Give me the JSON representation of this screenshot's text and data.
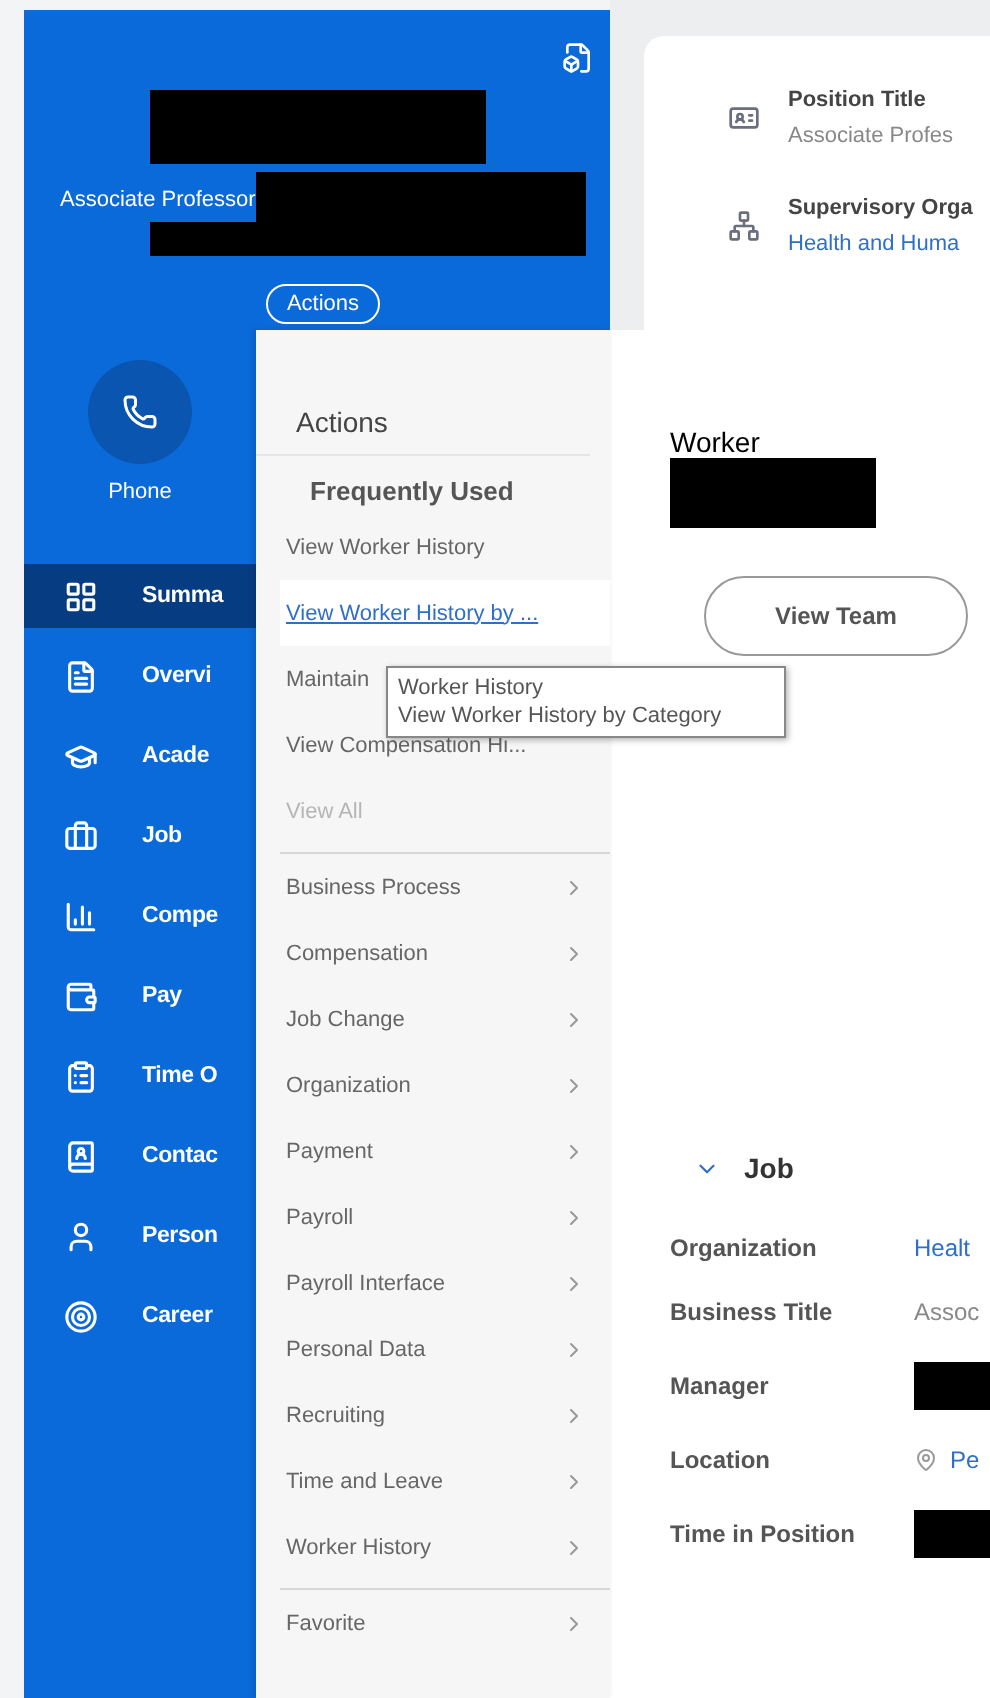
{
  "profile": {
    "subtitle": "Associate Professor",
    "actions_button": "Actions",
    "contact": {
      "label": "Phone"
    }
  },
  "nav": [
    {
      "label": "Summa",
      "selected": true
    },
    {
      "label": "Overvi",
      "selected": false
    },
    {
      "label": "Acade",
      "selected": false
    },
    {
      "label": "Job",
      "selected": false
    },
    {
      "label": "Compe",
      "selected": false
    },
    {
      "label": "Pay",
      "selected": false
    },
    {
      "label": "Time O",
      "selected": false
    },
    {
      "label": "Contac",
      "selected": false
    },
    {
      "label": "Person",
      "selected": false
    },
    {
      "label": "Career",
      "selected": false
    }
  ],
  "actions_menu": {
    "title": "Actions",
    "sections": [
      {
        "heading": "Frequently Used",
        "items": [
          {
            "label": "View Worker History",
            "kind": "action",
            "highlighted": false,
            "disabled": false
          },
          {
            "label": "View Worker History by ...",
            "kind": "action",
            "highlighted": true,
            "disabled": false
          },
          {
            "label": "Maintain",
            "kind": "action",
            "highlighted": false,
            "disabled": false
          },
          {
            "label": "View Compensation Hi...",
            "kind": "action",
            "highlighted": false,
            "disabled": false
          },
          {
            "label": "View All",
            "kind": "action",
            "highlighted": false,
            "disabled": true
          }
        ]
      },
      {
        "items": [
          {
            "label": "Business Process",
            "kind": "submenu"
          },
          {
            "label": "Compensation",
            "kind": "submenu"
          },
          {
            "label": "Job Change",
            "kind": "submenu"
          },
          {
            "label": "Organization",
            "kind": "submenu"
          },
          {
            "label": "Payment",
            "kind": "submenu"
          },
          {
            "label": "Payroll",
            "kind": "submenu"
          },
          {
            "label": "Payroll Interface",
            "kind": "submenu"
          },
          {
            "label": "Personal Data",
            "kind": "submenu"
          },
          {
            "label": "Recruiting",
            "kind": "submenu"
          },
          {
            "label": "Time and Leave",
            "kind": "submenu"
          },
          {
            "label": "Worker History",
            "kind": "submenu"
          }
        ]
      },
      {
        "items": [
          {
            "label": "Favorite",
            "kind": "submenu"
          }
        ]
      }
    ]
  },
  "tooltip": {
    "lines": [
      "Worker History",
      "View Worker History by Category"
    ]
  },
  "summary_card": [
    {
      "label": "Position Title",
      "value": "Associate Profes",
      "kind": "text"
    },
    {
      "label": "Supervisory Orga",
      "value": "Health and Huma",
      "kind": "link"
    }
  ],
  "worker": {
    "label": "Worker",
    "view_team_button": "View Team"
  },
  "job_section": {
    "title": "Job",
    "expanded": true,
    "fields": [
      {
        "label": "Organization",
        "value": "Healt",
        "kind": "link"
      },
      {
        "label": "Business Title",
        "value": "Assoc",
        "kind": "text"
      },
      {
        "label": "Manager",
        "kind": "redacted"
      },
      {
        "label": "Location",
        "value": "Pe",
        "kind": "location"
      },
      {
        "label": "Time in Position",
        "kind": "redacted"
      }
    ]
  }
}
